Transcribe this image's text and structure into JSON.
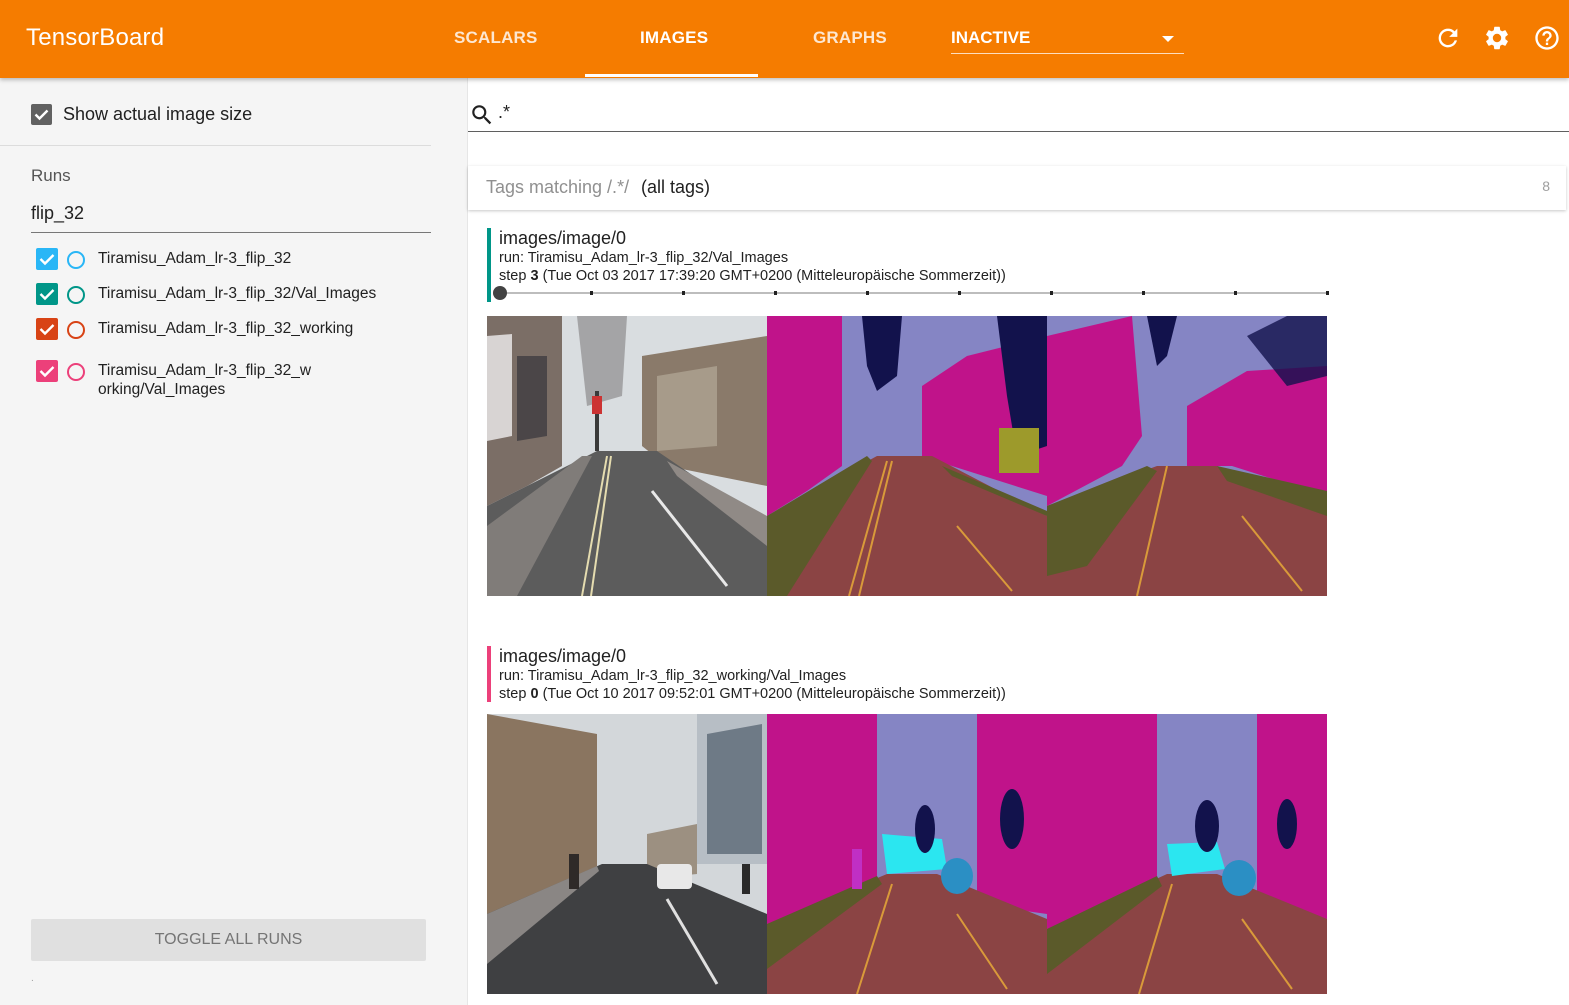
{
  "header": {
    "brand": "TensorBoard",
    "tabs": [
      {
        "label": "SCALARS",
        "active": false
      },
      {
        "label": "IMAGES",
        "active": true
      },
      {
        "label": "GRAPHS",
        "active": false
      }
    ],
    "inactive_dropdown": "INACTIVE",
    "icons": [
      "refresh-icon",
      "settings-icon",
      "help-icon"
    ],
    "color": "#f57c00"
  },
  "sidebar": {
    "show_actual_size_label": "Show actual image size",
    "show_actual_size_checked": true,
    "runs_title": "Runs",
    "runs_filter": "flip_32",
    "runs": [
      {
        "label": "Tiramisu_Adam_lr-3_flip_32",
        "color": "#29b6f6",
        "checked": true
      },
      {
        "label": "Tiramisu_Adam_lr-3_flip_32/Val_Images",
        "color": "#009688",
        "checked": true
      },
      {
        "label": "Tiramisu_Adam_lr-3_flip_32_working",
        "color": "#d84315",
        "checked": true
      },
      {
        "label": "Tiramisu_Adam_lr-3_flip_32_working/Val_Images",
        "color": "#ec407a",
        "checked": true
      }
    ],
    "toggle_all_label": "TOGGLE ALL RUNS",
    "footer_dot": "."
  },
  "main": {
    "search_value": ".*",
    "tags_prefix": "Tags matching /.*/",
    "tags_suffix": "(all tags)",
    "tags_count": "8",
    "cards": [
      {
        "title": "images/image/0",
        "run": "run: Tiramisu_Adam_lr-3_flip_32/Val_Images",
        "step_label": "step",
        "step": "3",
        "time": "(Tue Oct 03 2017 17:39:20 GMT+0200 (Mitteleuropäische Sommerzeit))",
        "color": "#009688",
        "slider_steps": 10,
        "slider_position": 0
      },
      {
        "title": "images/image/0",
        "run": "run: Tiramisu_Adam_lr-3_flip_32_working/Val_Images",
        "step_label": "step",
        "step": "0",
        "time": "(Tue Oct 10 2017 09:52:01 GMT+0200 (Mitteleuropäische Sommerzeit))",
        "color": "#ec407a"
      }
    ]
  }
}
